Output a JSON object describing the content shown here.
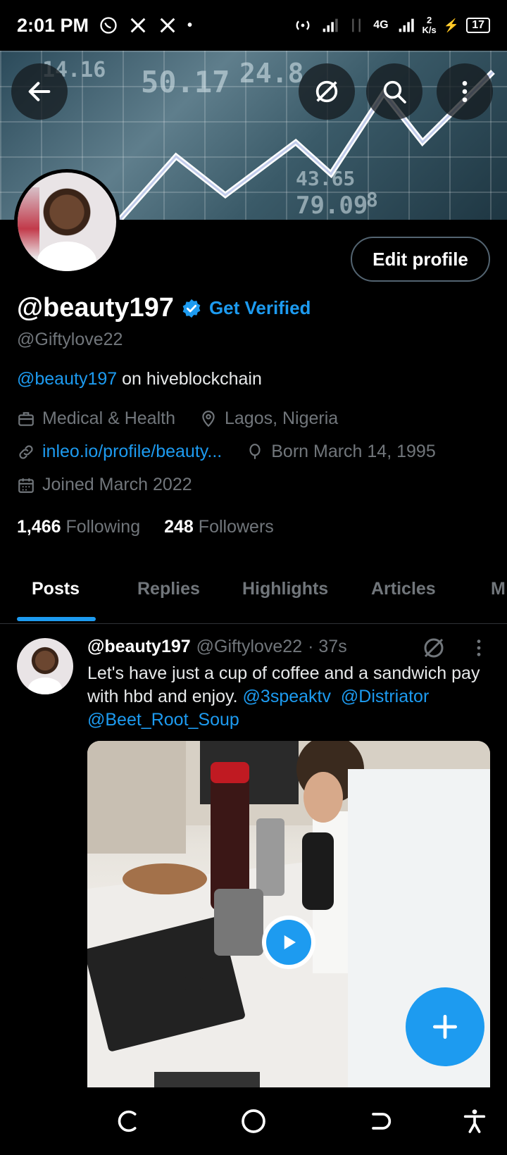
{
  "status_bar": {
    "time": "2:01 PM",
    "network_4g": "4G",
    "speed_value": "2",
    "speed_unit": "K/s",
    "battery": "17"
  },
  "profile": {
    "display_name": "@beauty197",
    "get_verified_label": "Get Verified",
    "handle": "@Giftylove22",
    "bio_mention": "@beauty197",
    "bio_text": " on hiveblockchain",
    "category": "Medical & Health",
    "location": "Lagos, Nigeria",
    "website": "inleo.io/profile/beauty...",
    "birthday": "Born March 14, 1995",
    "joined": "Joined March 2022",
    "following_count": "1,466",
    "following_label": "Following",
    "followers_count": "248",
    "followers_label": "Followers",
    "edit_profile_label": "Edit profile"
  },
  "banner_numbers": [
    "14.16",
    "50.17",
    "24.8",
    "43.65",
    "79.09",
    "8"
  ],
  "tabs": [
    {
      "label": "Posts",
      "active": true
    },
    {
      "label": "Replies",
      "active": false
    },
    {
      "label": "Highlights",
      "active": false
    },
    {
      "label": "Articles",
      "active": false
    },
    {
      "label": "M",
      "active": false
    }
  ],
  "post": {
    "author": "@beauty197",
    "handle": "@Giftylove22",
    "time": "· 37s",
    "text": "Let's have just a cup of coffee and a sandwich pay with hbd and enjoy. ",
    "mention1": "@3speaktv",
    "mention2": "@Distriator",
    "mention3": "@Beet_Root_Soup"
  },
  "colors": {
    "accent": "#1d9bf0",
    "background": "#000000",
    "muted": "#71767b",
    "text": "#e7e9ea"
  },
  "icons": [
    "back-arrow-icon",
    "grok-icon",
    "search-icon",
    "more-vertical-icon",
    "verified-badge-icon",
    "briefcase-icon",
    "location-pin-icon",
    "link-icon",
    "balloon-icon",
    "calendar-icon",
    "play-icon",
    "plus-icon"
  ]
}
